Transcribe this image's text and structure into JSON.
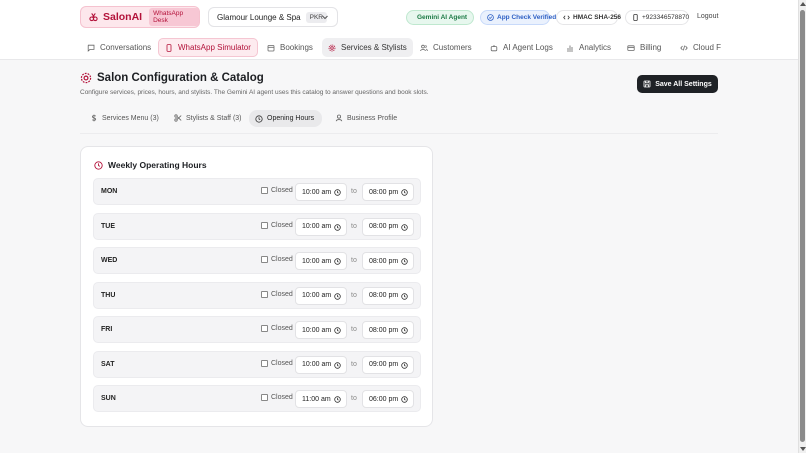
{
  "brand": {
    "name": "SalonAI",
    "tag": "WhatsApp Desk"
  },
  "salon_selector": {
    "name": "Glamour Lounge & Spa",
    "currency": "PKR"
  },
  "status": {
    "gemini": "Gemini AI Agent",
    "app_check": "App Check Verified",
    "hmac": "HMAC SHA-256",
    "phone": "+923346578870",
    "logout": "Logout"
  },
  "nav": {
    "conversations": "Conversations",
    "whatsapp_simulator": "WhatsApp Simulator",
    "bookings": "Bookings",
    "services_stylists": "Services & Stylists",
    "customers": "Customers",
    "ai_agent_logs": "AI Agent Logs",
    "analytics": "Analytics",
    "billing": "Billing",
    "cloud": "Cloud F"
  },
  "page": {
    "title": "Salon Configuration & Catalog",
    "description": "Configure services, prices, hours, and stylists. The Gemini AI agent uses this catalog to answer questions and book slots.",
    "save_label": "Save All Settings"
  },
  "subtabs": {
    "services": "Services Menu (3)",
    "stylists": "Stylists & Staff (3)",
    "hours": "Opening Hours",
    "profile": "Business Profile"
  },
  "hours_card": {
    "title": "Weekly Operating Hours",
    "closed_label": "Closed",
    "to_label": "to",
    "days": [
      {
        "day": "MON",
        "open": "10:00 am",
        "close": "08:00 pm",
        "closed": false
      },
      {
        "day": "TUE",
        "open": "10:00 am",
        "close": "08:00 pm",
        "closed": false
      },
      {
        "day": "WED",
        "open": "10:00 am",
        "close": "08:00 pm",
        "closed": false
      },
      {
        "day": "THU",
        "open": "10:00 am",
        "close": "08:00 pm",
        "closed": false
      },
      {
        "day": "FRI",
        "open": "10:00 am",
        "close": "08:00 pm",
        "closed": false
      },
      {
        "day": "SAT",
        "open": "10:00 am",
        "close": "09:00 pm",
        "closed": false
      },
      {
        "day": "SUN",
        "open": "11:00 am",
        "close": "06:00 pm",
        "closed": false
      }
    ]
  },
  "colors": {
    "brand": "#b3123a",
    "primary_button": "#1f2226",
    "gemini_green": "#1c7a45",
    "appcheck_blue": "#2d5fc4"
  }
}
